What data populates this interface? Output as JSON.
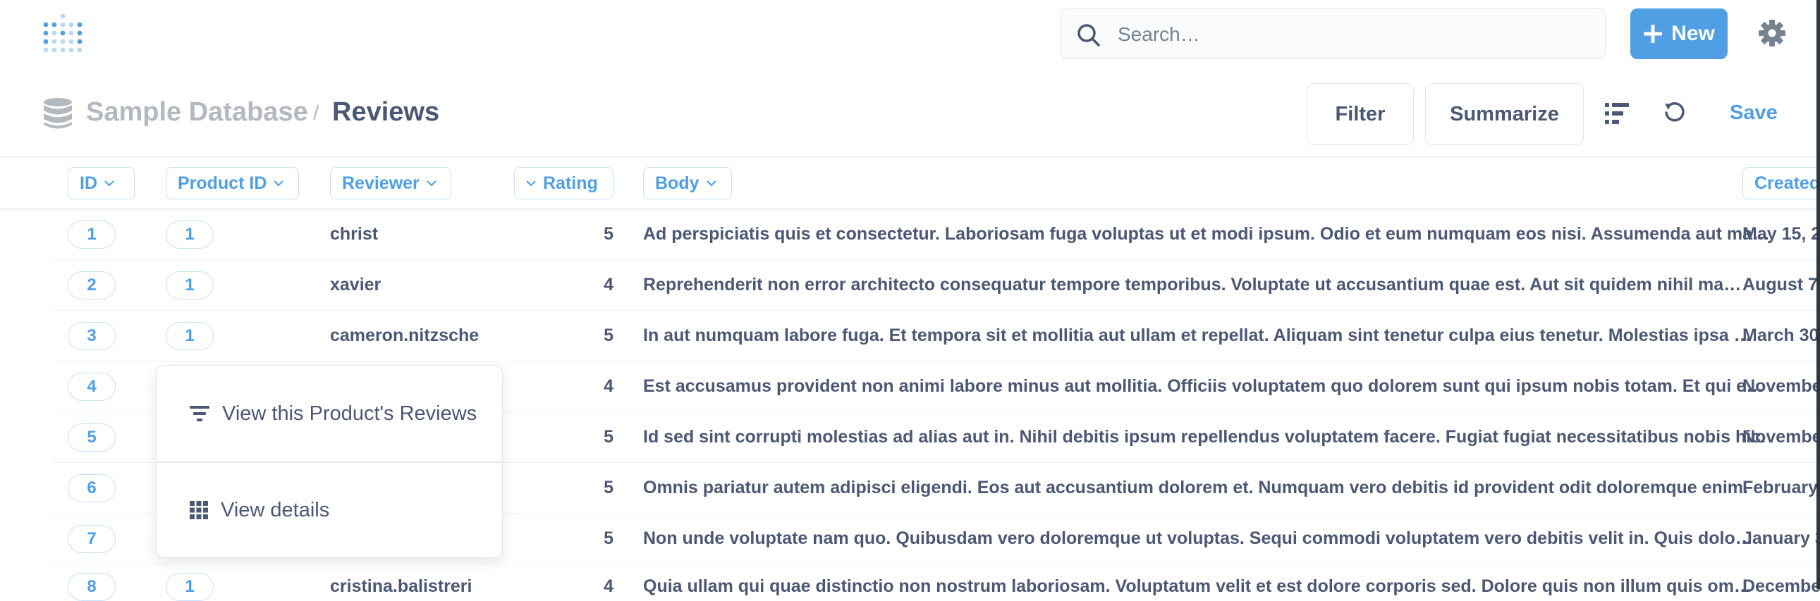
{
  "search": {
    "placeholder": "Search…"
  },
  "toolbar": {
    "new_label": "New"
  },
  "breadcrumb": {
    "database": "Sample Database",
    "separator": "/",
    "table": "Reviews"
  },
  "actions": {
    "filter": "Filter",
    "summarize": "Summarize",
    "save": "Save"
  },
  "columns": [
    "ID",
    "Product ID",
    "Reviewer",
    "Rating",
    "Body",
    "Created"
  ],
  "rows": [
    {
      "id": "1",
      "product_id": "1",
      "reviewer": "christ",
      "rating": "5",
      "body": "Ad perspiciatis quis et consectetur. Laboriosam fuga voluptas ut et modi ipsum. Odio et eum numquam eos nisi. Assumenda aut ma…",
      "created": "May 15, 2"
    },
    {
      "id": "2",
      "product_id": "1",
      "reviewer": "xavier",
      "rating": "4",
      "body": "Reprehenderit non error architecto consequatur tempore temporibus. Voluptate ut accusantium quae est. Aut sit quidem nihil ma…",
      "created": "August 7,"
    },
    {
      "id": "3",
      "product_id": "1",
      "reviewer": "cameron.nitzsche",
      "rating": "5",
      "body": "In aut numquam labore fuga. Et tempora sit et mollitia aut ullam et repellat. Aliquam sint tenetur culpa eius tenetur. Molestias ipsa …",
      "created": "March 30"
    },
    {
      "id": "4",
      "product_id": "",
      "reviewer": "",
      "rating": "4",
      "body": "Est accusamus provident non animi labore minus aut mollitia. Officiis voluptatem quo dolorem sunt qui ipsum nobis totam. Et qui e…",
      "created": "Novembe"
    },
    {
      "id": "5",
      "product_id": "",
      "reviewer": "",
      "rating": "5",
      "body": "Id sed sint corrupti molestias ad alias aut in. Nihil debitis ipsum repellendus voluptatem facere. Fugiat fugiat necessitatibus nobis hic.",
      "created": "Novembe"
    },
    {
      "id": "6",
      "product_id": "",
      "reviewer": "",
      "rating": "5",
      "body": "Omnis pariatur autem adipisci eligendi. Eos aut accusantium dolorem et. Numquam vero debitis id provident odit doloremque enim.",
      "created": "February"
    },
    {
      "id": "7",
      "product_id": "",
      "reviewer": "",
      "rating": "5",
      "body": "Non unde voluptate nam quo. Quibusdam vero doloremque ut voluptas. Sequi commodi voluptatem vero debitis velit in. Quis dolo…",
      "created": "January 3"
    },
    {
      "id": "8",
      "product_id": "1",
      "reviewer": "cristina.balistreri",
      "rating": "4",
      "body": "Quia ullam qui quae distinctio non nostrum laboriosam. Voluptatum velit et est dolore corporis sed. Dolore quis non illum quis om…",
      "created": "Decembe"
    }
  ],
  "popover": {
    "item1": "View this Product's Reviews",
    "item2": "View details"
  },
  "colors": {
    "accent": "#509ee3",
    "text": "#4c5773",
    "muted": "#b4b8bf",
    "border": "#e3e6ea"
  }
}
